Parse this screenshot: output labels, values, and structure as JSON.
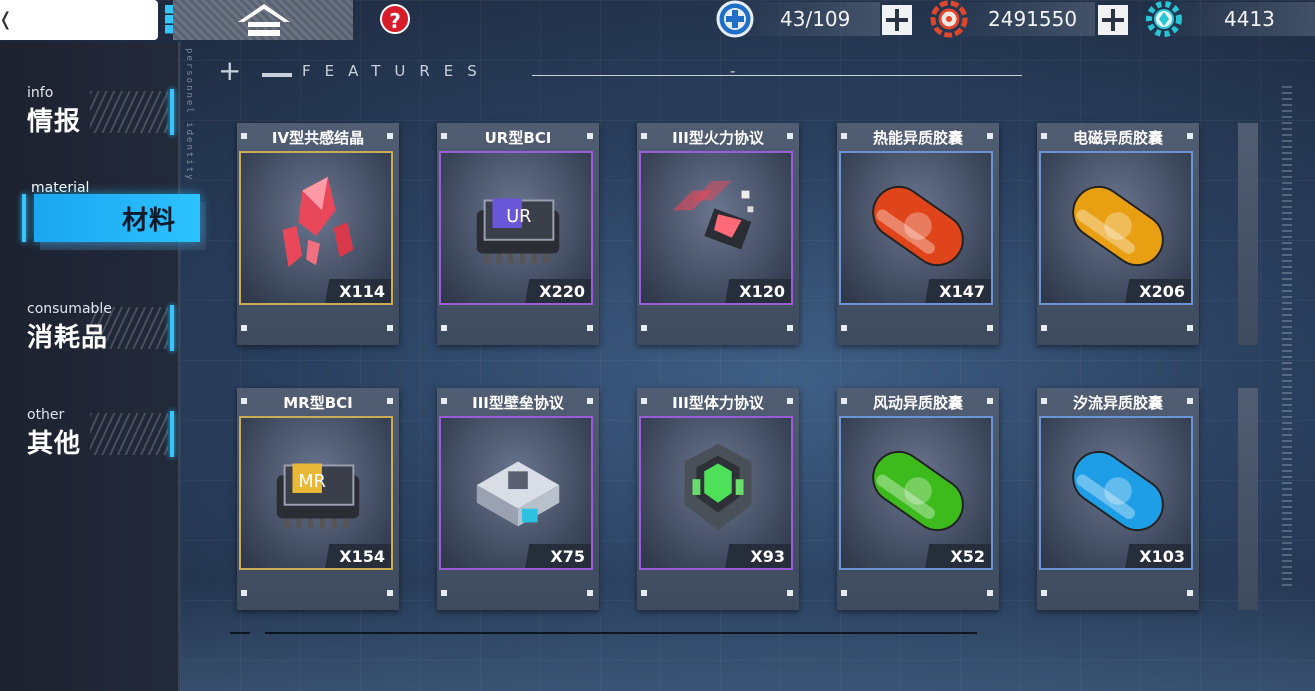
{
  "topbar": {
    "home_icon": "home-icon",
    "help_icon": "question-icon",
    "help_label": "?",
    "resources": [
      {
        "icon": "stamina-plus-icon",
        "value": "43/109",
        "color": "#2b7fd8"
      },
      {
        "icon": "coin-gear-icon",
        "value": "2491550",
        "color": "#e0462c"
      },
      {
        "icon": "crystal-gear-icon",
        "value": "4413",
        "color": "#26c6d6"
      }
    ]
  },
  "features": {
    "cross": "+",
    "label": "FEATURES",
    "suffix": "-",
    "vertical_text": "personnel identity"
  },
  "sidebar": {
    "items": [
      {
        "en": "info",
        "zh": "情报"
      },
      {
        "en": "material",
        "zh": "材料",
        "active": true
      },
      {
        "en": "consumable",
        "zh": "消耗品"
      },
      {
        "en": "other",
        "zh": "其他"
      }
    ]
  },
  "items": [
    {
      "name": "IV型共感结晶",
      "qty": "X114",
      "icon": "red-crystal-icon",
      "rarity": "gold"
    },
    {
      "name": "UR型BCI",
      "qty": "X220",
      "icon": "ur-chip-icon",
      "rarity": "purple"
    },
    {
      "name": "III型火力协议",
      "qty": "X120",
      "icon": "firepower-protocol-icon",
      "rarity": "purple"
    },
    {
      "name": "热能异质胶囊",
      "qty": "X147",
      "icon": "thermal-capsule-icon",
      "rarity": "blue",
      "color": "#e0441a"
    },
    {
      "name": "电磁异质胶囊",
      "qty": "X206",
      "icon": "electromagnetic-capsule-icon",
      "rarity": "blue",
      "color": "#e8a012"
    },
    {
      "name": "MR型BCI",
      "qty": "X154",
      "icon": "mr-chip-icon",
      "rarity": "gold"
    },
    {
      "name": "III型壁垒协议",
      "qty": "X75",
      "icon": "barrier-protocol-icon",
      "rarity": "purple"
    },
    {
      "name": "III型体力协议",
      "qty": "X93",
      "icon": "stamina-protocol-icon",
      "rarity": "purple"
    },
    {
      "name": "风动异质胶囊",
      "qty": "X52",
      "icon": "wind-capsule-icon",
      "rarity": "blue",
      "color": "#3dbb1c"
    },
    {
      "name": "汐流异质胶囊",
      "qty": "X103",
      "icon": "tide-capsule-icon",
      "rarity": "blue",
      "color": "#1e9ee6"
    }
  ]
}
